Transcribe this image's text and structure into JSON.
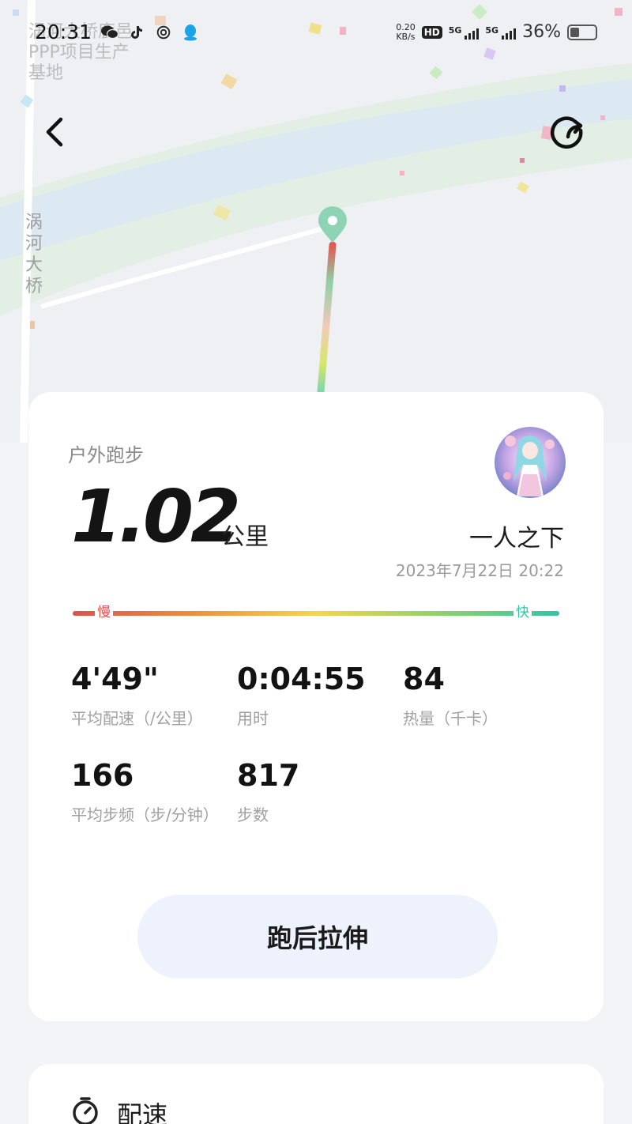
{
  "status_bar": {
    "time": "20:31",
    "net_speed_value": "0.20",
    "net_speed_unit": "KB/s",
    "hd_label": "HD",
    "sim1_label": "5G",
    "sim2_label": "5G",
    "battery_percent": "36%",
    "battery_level": 0.36
  },
  "map": {
    "label_top": "涡河大桥鹿邑PPP项目生产基地",
    "label_bridge": "涡河大桥"
  },
  "header": {
    "back_icon": "chevron-left-icon",
    "share_icon": "share-icon"
  },
  "summary": {
    "activity_type": "户外跑步",
    "distance_value": "1.02",
    "distance_unit": "公里",
    "username": "一人之下",
    "datetime": "2023年7月22日 20:22",
    "pace_scale": {
      "slow_label": "慢",
      "fast_label": "快",
      "colors": [
        "#d9534f",
        "#ef8f3c",
        "#f5d54a",
        "#8fd26a",
        "#35c4a5"
      ]
    },
    "stats": [
      {
        "value": "4'49\"",
        "label": "平均配速（/公里）"
      },
      {
        "value": "0:04:55",
        "label": "用时"
      },
      {
        "value": "84",
        "label": "热量（千卡）"
      },
      {
        "value": "166",
        "label": "平均步频（步/分钟）"
      },
      {
        "value": "817",
        "label": "步数"
      }
    ],
    "stretch_button_label": "跑后拉伸"
  },
  "pace_section": {
    "title": "配速",
    "icon": "stopwatch-icon"
  }
}
